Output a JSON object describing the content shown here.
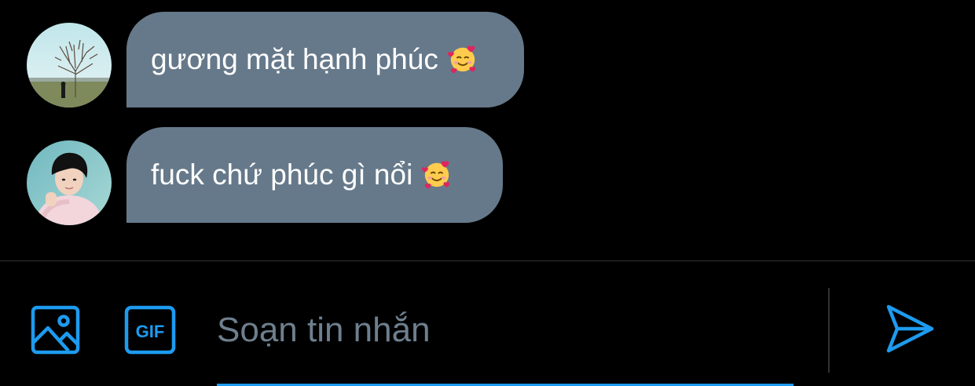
{
  "messages": [
    {
      "avatar": "avatar-tree-landscape",
      "text": "gương mặt hạnh phúc",
      "emoji": "smiling-face-with-hearts"
    },
    {
      "avatar": "avatar-person-portrait",
      "text": "fuck chứ phúc gì nổi",
      "emoji": "smiling-face-with-hearts"
    }
  ],
  "composer": {
    "placeholder": "Soạn tin nhắn",
    "value": "",
    "image_icon": "image-icon",
    "gif_icon": "gif-icon",
    "gif_label": "GIF",
    "send_icon": "send-icon"
  },
  "colors": {
    "background": "#000000",
    "bubble": "#66798a",
    "accent": "#1d9bf0",
    "placeholder": "#6e7f8e",
    "divider": "#2f3336"
  }
}
